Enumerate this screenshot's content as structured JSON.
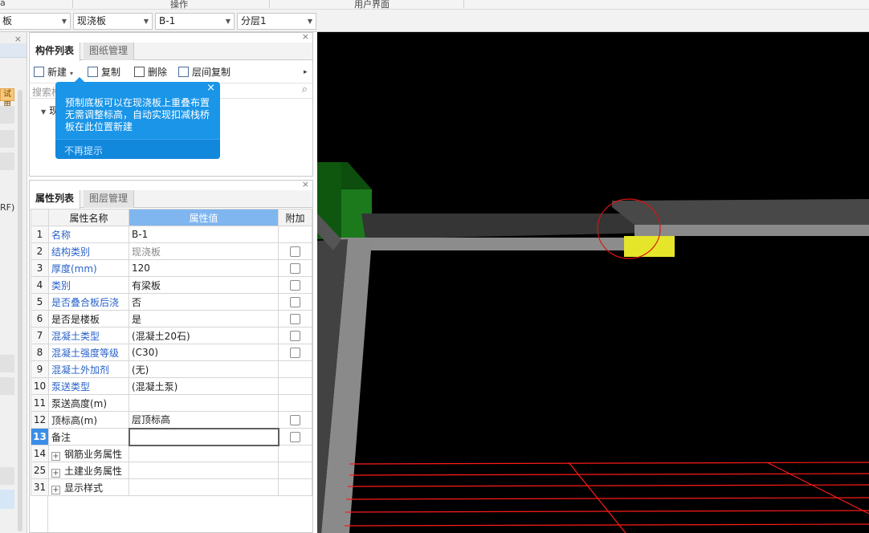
{
  "ribbon": {
    "label_left": "a",
    "label_operation": "操作",
    "label_ui": "用户界面"
  },
  "selectors": {
    "floor_type": "板",
    "component_type": "现浇板",
    "component_name": "B-1",
    "layer": "分层1"
  },
  "left_strip": {
    "tag": "试用",
    "partial_text": "RF)"
  },
  "component_panel": {
    "tabs": [
      "构件列表",
      "图纸管理"
    ],
    "toolbar": {
      "new": "新建",
      "copy": "复制",
      "delete": "删除",
      "floor_copy": "层间复制",
      "more": "▸"
    },
    "search_placeholder": "搜索构",
    "tree_item": "现"
  },
  "tooltip": {
    "text": "预制底板可以在现浇板上重叠布置无需调整标高，自动实现扣减栈桥板在此位置新建",
    "dismiss": "不再提示",
    "close": "×"
  },
  "property_panel": {
    "tabs": [
      "属性列表",
      "图层管理"
    ],
    "headers": {
      "name": "属性名称",
      "value": "属性值",
      "extra": "附加"
    },
    "rows": [
      {
        "idx": "1",
        "name": "名称",
        "value": "B-1",
        "blue": true,
        "check": false
      },
      {
        "idx": "2",
        "name": "结构类别",
        "value": "现浇板",
        "blue": true,
        "gray": true,
        "check": true
      },
      {
        "idx": "3",
        "name": "厚度(mm)",
        "value": "120",
        "blue": true,
        "check": true
      },
      {
        "idx": "4",
        "name": "类别",
        "value": "有梁板",
        "blue": true,
        "check": true
      },
      {
        "idx": "5",
        "name": "是否叠合板后浇",
        "value": "否",
        "blue": true,
        "check": true
      },
      {
        "idx": "6",
        "name": "是否是楼板",
        "value": "是",
        "blue": false,
        "check": true
      },
      {
        "idx": "7",
        "name": "混凝土类型",
        "value": "(混凝土20石)",
        "blue": true,
        "check": true
      },
      {
        "idx": "8",
        "name": "混凝土强度等级",
        "value": "(C30)",
        "blue": true,
        "check": true
      },
      {
        "idx": "9",
        "name": "混凝土外加剂",
        "value": "(无)",
        "blue": true,
        "check": false
      },
      {
        "idx": "10",
        "name": "泵送类型",
        "value": "(混凝土泵)",
        "blue": true,
        "check": false
      },
      {
        "idx": "11",
        "name": "泵送高度(m)",
        "value": "",
        "blue": false,
        "check": false
      },
      {
        "idx": "12",
        "name": "顶标高(m)",
        "value": "层顶标高",
        "blue": false,
        "check": true
      },
      {
        "idx": "13",
        "name": "备注",
        "value": "",
        "blue": false,
        "check": true,
        "selected": true
      },
      {
        "idx": "14",
        "name": "钢筋业务属性",
        "value": "",
        "expand": true,
        "check": false
      },
      {
        "idx": "25",
        "name": "土建业务属性",
        "value": "",
        "expand": true,
        "check": false
      },
      {
        "idx": "31",
        "name": "显示样式",
        "value": "",
        "expand": true,
        "check": false
      }
    ]
  },
  "colors": {
    "accent": "#1a95e8",
    "viewport_bg": "#000000",
    "highlight": "#e5e52a",
    "grid": "#ff1a1a",
    "column": "#1e7d1e"
  }
}
